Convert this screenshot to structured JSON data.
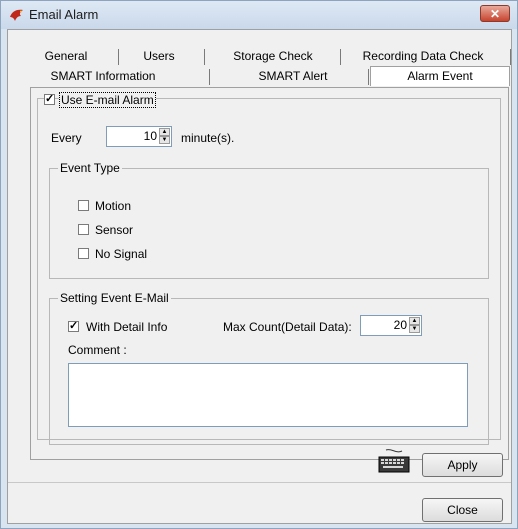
{
  "window": {
    "title": "Email Alarm",
    "close_glyph": "✕"
  },
  "tabs": {
    "row1": [
      "General",
      "Users",
      "Storage Check",
      "Recording Data Check"
    ],
    "row2": [
      "SMART Information",
      "SMART Alert",
      "Alarm Event"
    ],
    "active": "Alarm Event"
  },
  "alarm": {
    "use_email_label": "Use E-mail Alarm",
    "use_email_checked": true,
    "every_label": "Every",
    "every_value": "10",
    "minutes_label": "minute(s)."
  },
  "event_type": {
    "title": "Event Type",
    "items": [
      {
        "label": "Motion",
        "checked": false
      },
      {
        "label": "Sensor",
        "checked": false
      },
      {
        "label": "No Signal",
        "checked": false
      }
    ]
  },
  "setting_email": {
    "title": "Setting Event E-Mail",
    "detail_info_label": "With Detail Info",
    "detail_info_checked": true,
    "max_count_label": "Max Count(Detail Data):",
    "max_count_value": "20",
    "comment_label": "Comment :",
    "comment_value": ""
  },
  "buttons": {
    "apply": "Apply",
    "close": "Close"
  },
  "icons": {
    "app": "dragon-app-icon",
    "keyboard": "keyboard-icon"
  },
  "colors": {
    "title_bg": "#c9d8eb",
    "close_btn": "#c7442e",
    "panel_bg": "#f0f0f0"
  }
}
